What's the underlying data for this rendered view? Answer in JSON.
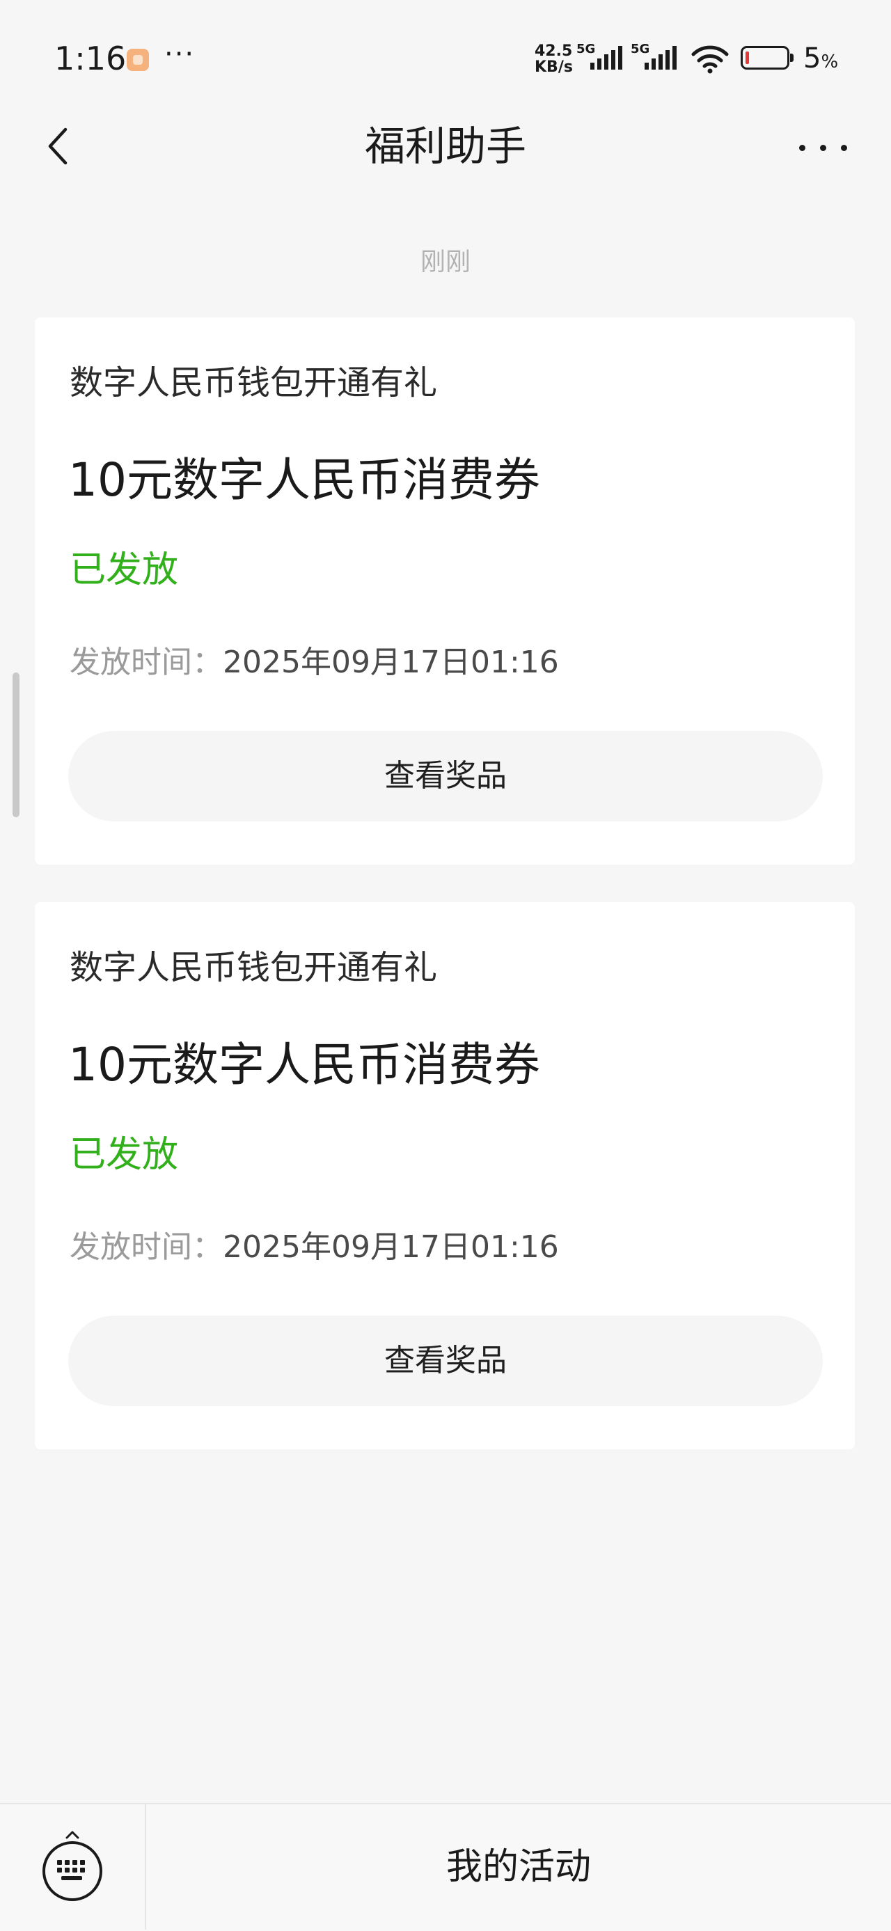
{
  "status_bar": {
    "time": "1:16",
    "more": "···",
    "net_speed_value": "42.5",
    "net_speed_unit": "KB/s",
    "network_1": "5G",
    "network_2": "5G",
    "battery_value": "5",
    "battery_unit": "%",
    "battery_color": "#e53935"
  },
  "nav": {
    "title": "福利助手"
  },
  "timestamp": "刚刚",
  "cards": [
    {
      "activity": "数字人民币钱包开通有礼",
      "prize": "10元数字人民币消费券",
      "status": "已发放",
      "time_label": "发放时间：",
      "time_value": "2025年09月17日01:16",
      "button": "查看奖品"
    },
    {
      "activity": "数字人民币钱包开通有礼",
      "prize": "10元数字人民币消费券",
      "status": "已发放",
      "time_label": "发放时间：",
      "time_value": "2025年09月17日01:16",
      "button": "查看奖品"
    }
  ],
  "bottom_bar": {
    "keyboard_icon": "keyboard-icon",
    "menu_label": "我的活动"
  },
  "colors": {
    "status_green": "#32b01c",
    "background": "#f6f6f6"
  }
}
